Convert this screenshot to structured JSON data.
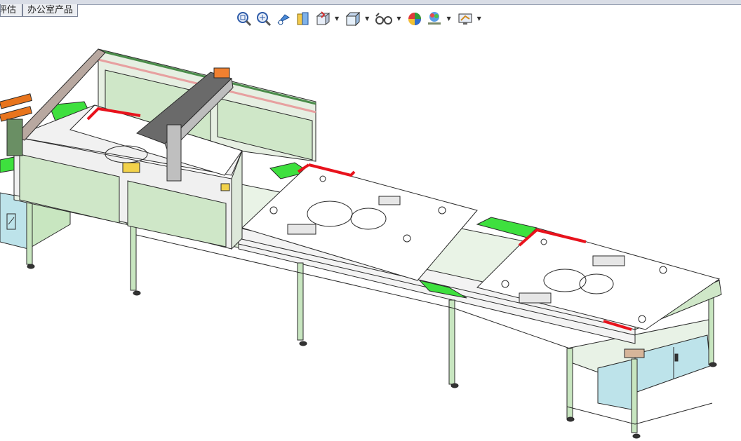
{
  "tabs": [
    {
      "label": "评估"
    },
    {
      "label": "办公室产品"
    }
  ],
  "toolbar": {
    "items": [
      {
        "icon": "zoom-to-fit-icon",
        "dropdown": false
      },
      {
        "icon": "zoom-to-area-icon",
        "dropdown": false
      },
      {
        "icon": "previous-view-icon",
        "dropdown": false
      },
      {
        "icon": "section-view-icon",
        "dropdown": false
      },
      {
        "icon": "view-orientation-icon",
        "dropdown": true
      },
      {
        "icon": "display-style-icon",
        "dropdown": true
      },
      {
        "icon": "hide-show-items-icon",
        "dropdown": true
      },
      {
        "icon": "edit-appearance-icon",
        "dropdown": false
      },
      {
        "icon": "apply-scene-icon",
        "dropdown": true
      },
      {
        "icon": "view-settings-icon",
        "dropdown": true
      }
    ]
  },
  "colors": {
    "frame_green": "#c8e6c0",
    "panel_green": "#cfe7c8",
    "belt_green": "#3ee03e",
    "marker_red": "#e8121c",
    "cabinet_blue": "#bde3ea",
    "outline": "#2a2a2a"
  }
}
